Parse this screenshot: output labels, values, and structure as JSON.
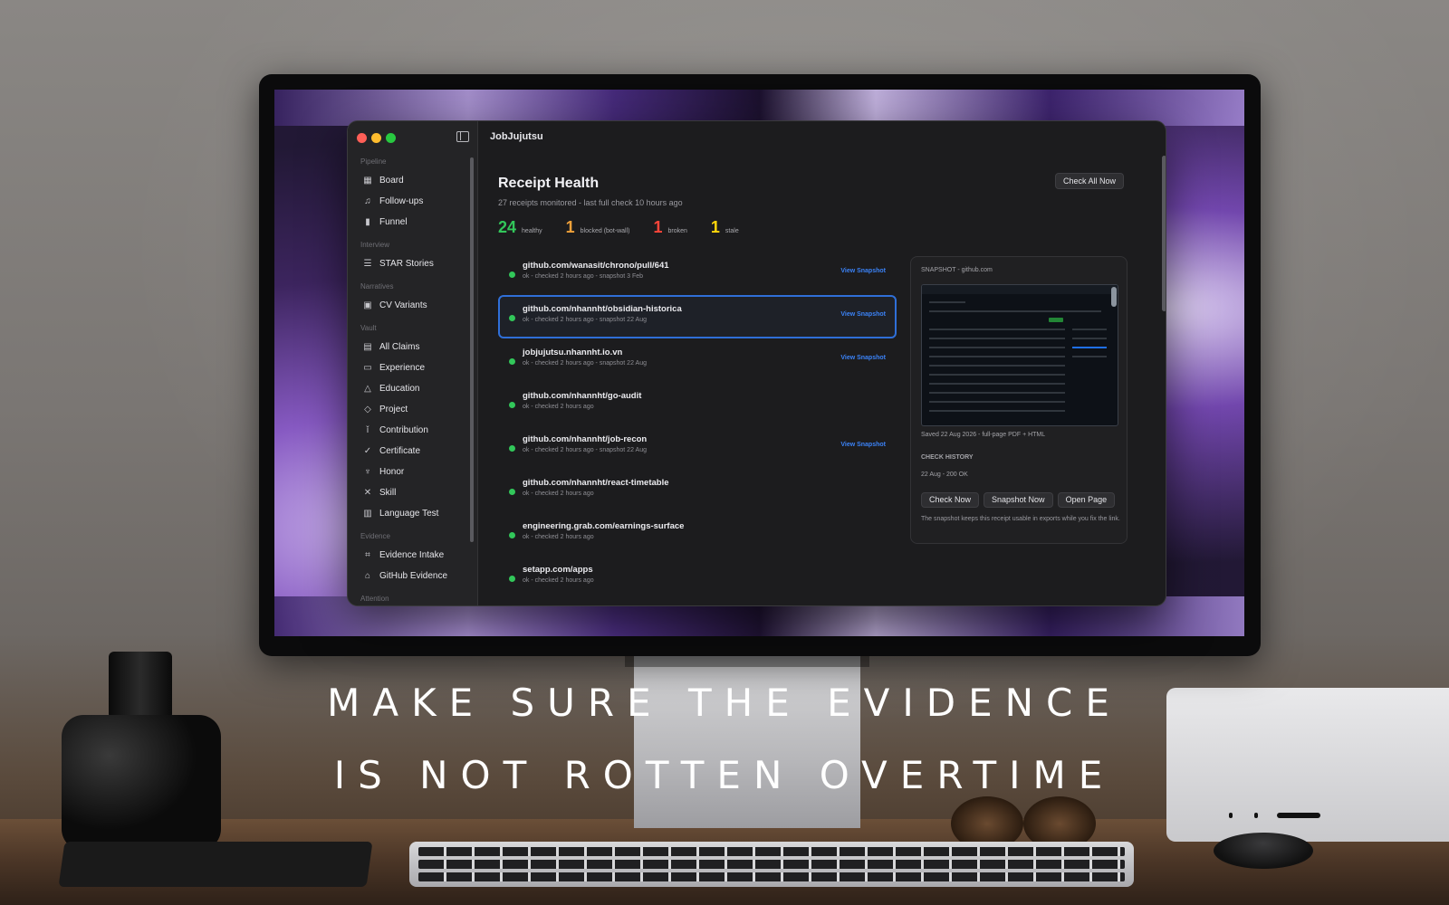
{
  "app": {
    "title": "JobJujutsu"
  },
  "colors": {
    "accent": "#3b82f6",
    "healthy": "#32c75a",
    "blocked": "#f0a13a",
    "broken": "#ff453a",
    "stale": "#ffd60a"
  },
  "sidebar": {
    "sections": [
      {
        "title": "Pipeline",
        "items": [
          {
            "label": "Board",
            "icon": "board-icon"
          },
          {
            "label": "Follow-ups",
            "icon": "bell-icon"
          },
          {
            "label": "Funnel",
            "icon": "bar-chart-icon"
          }
        ]
      },
      {
        "title": "Interview",
        "items": [
          {
            "label": "STAR Stories",
            "icon": "list-icon"
          }
        ]
      },
      {
        "title": "Narratives",
        "items": [
          {
            "label": "CV Variants",
            "icon": "documents-icon"
          }
        ]
      },
      {
        "title": "Vault",
        "items": [
          {
            "label": "All Claims",
            "icon": "tray-icon"
          },
          {
            "label": "Experience",
            "icon": "briefcase-icon"
          },
          {
            "label": "Education",
            "icon": "graduation-cap-icon"
          },
          {
            "label": "Project",
            "icon": "cube-icon"
          },
          {
            "label": "Contribution",
            "icon": "person-icon"
          },
          {
            "label": "Certificate",
            "icon": "seal-icon"
          },
          {
            "label": "Honor",
            "icon": "trophy-icon"
          },
          {
            "label": "Skill",
            "icon": "tools-icon"
          },
          {
            "label": "Language Test",
            "icon": "test-doc-icon"
          }
        ]
      },
      {
        "title": "Evidence",
        "items": [
          {
            "label": "Evidence Intake",
            "icon": "scan-icon"
          },
          {
            "label": "GitHub Evidence",
            "icon": "github-icon"
          }
        ]
      },
      {
        "title": "Attention",
        "items": []
      }
    ]
  },
  "header": {
    "title": "Receipt Health",
    "subtitle": "27 receipts monitored - last full check 10 hours ago",
    "check_all_label": "Check All Now"
  },
  "stats": [
    {
      "value": "24",
      "label": "healthy",
      "color": "#32c75a"
    },
    {
      "value": "1",
      "label": "blocked (bot-wall)",
      "color": "#f0a13a"
    },
    {
      "value": "1",
      "label": "broken",
      "color": "#ff453a"
    },
    {
      "value": "1",
      "label": "stale",
      "color": "#ffd60a"
    }
  ],
  "receipts": [
    {
      "url": "github.com/wanasit/chrono/pull/641",
      "meta": "ok - checked 2 hours ago - snapshot 3 Feb",
      "action": "View Snapshot"
    },
    {
      "url": "github.com/nhannht/obsidian-historica",
      "meta": "ok - checked 2 hours ago - snapshot 22 Aug",
      "action": "View Snapshot",
      "selected": true
    },
    {
      "url": "jobjujutsu.nhannht.io.vn",
      "meta": "ok - checked 2 hours ago - snapshot 22 Aug",
      "action": "View Snapshot"
    },
    {
      "url": "github.com/nhannht/go-audit",
      "meta": "ok - checked 2 hours ago",
      "action": ""
    },
    {
      "url": "github.com/nhannht/job-recon",
      "meta": "ok - checked 2 hours ago - snapshot 22 Aug",
      "action": "View Snapshot"
    },
    {
      "url": "github.com/nhannht/react-timetable",
      "meta": "ok - checked 2 hours ago",
      "action": ""
    },
    {
      "url": "engineering.grab.com/earnings-surface",
      "meta": "ok - checked 2 hours ago",
      "action": ""
    },
    {
      "url": "setapp.com/apps",
      "meta": "ok - checked 2 hours ago",
      "action": ""
    }
  ],
  "snapshot": {
    "title": "SNAPSHOT - github.com",
    "saved": "Saved 22 Aug 2026 - full-page PDF + HTML",
    "history_title": "CHECK HISTORY",
    "history_entry": "22 Aug - 200 OK",
    "buttons": [
      "Check Now",
      "Snapshot Now",
      "Open Page"
    ],
    "note": "The snapshot keeps this receipt usable in exports while you fix the link."
  },
  "caption": {
    "line1": "MAKE SURE THE EVIDENCE",
    "line2": "IS NOT ROTTEN OVERTIME"
  }
}
